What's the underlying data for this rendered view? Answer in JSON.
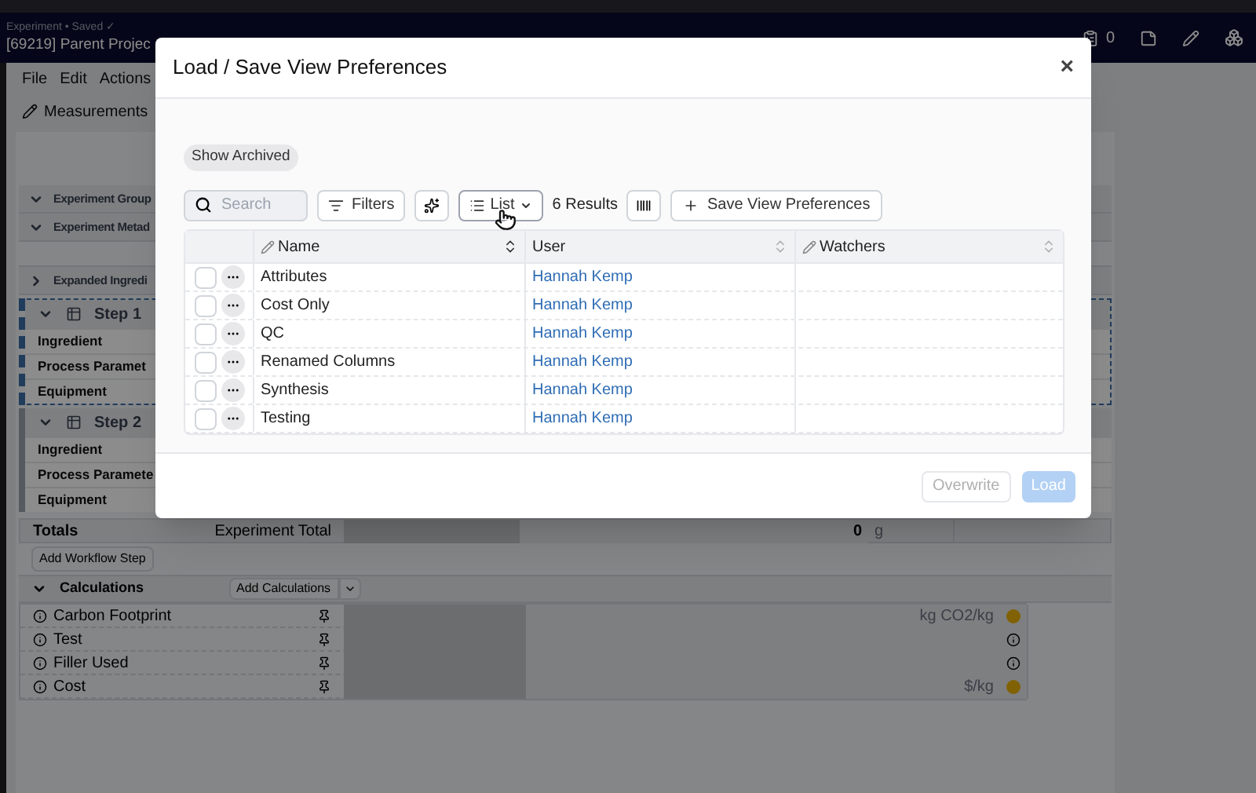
{
  "header": {
    "breadcrumb": "Experiment • Saved ✓",
    "title": "[69219] Parent Projec",
    "counter": "0"
  },
  "menu": [
    "File",
    "Edit",
    "Actions"
  ],
  "toolbar": {
    "tab": "Measurements"
  },
  "sections": [
    {
      "kind": "section",
      "label": "Experiment Group",
      "expanded": true
    },
    {
      "kind": "section",
      "label": "Experiment Metad",
      "expanded": true
    },
    {
      "kind": "spacer"
    },
    {
      "kind": "section",
      "label": "Expanded Ingredi",
      "expanded": false
    },
    {
      "kind": "step",
      "label": "Step 1",
      "expanded": true,
      "selected": true,
      "rows": [
        "Ingredient",
        "Process Paramet",
        "Equipment"
      ]
    },
    {
      "kind": "step",
      "label": "Step 2",
      "expanded": true,
      "selected": false,
      "rows": [
        "Ingredient",
        "Process Paramete",
        "Equipment"
      ]
    }
  ],
  "totals": {
    "label": "Totals",
    "name": "Experiment Total",
    "value": "0",
    "unit": "g"
  },
  "add_step_button": "Add Workflow Step",
  "calculations": {
    "label": "Calculations",
    "expanded": true,
    "add_button": "Add Calculations",
    "rows": [
      {
        "name": "Carbon Footprint",
        "unit": "kg CO2/kg",
        "kind": "warning"
      },
      {
        "name": "Test",
        "kind": "info"
      },
      {
        "name": "Filler Used",
        "kind": "info"
      },
      {
        "name": "Cost",
        "unit": "$/kg",
        "kind": "warning"
      }
    ]
  },
  "dialog": {
    "title": "Load / Save View Preferences",
    "close": "×",
    "show_archived": "Show Archived",
    "search": {
      "placeholder": "Search"
    },
    "filters": "Filters",
    "view": "List",
    "results": "6 Results",
    "save_button": "Save View Preferences",
    "columns": [
      {
        "label": "Name",
        "editable": true,
        "sorted": true
      },
      {
        "label": "User",
        "editable": false,
        "sorted": false
      },
      {
        "label": "Watchers",
        "editable": true,
        "sorted": false
      }
    ],
    "rows": [
      {
        "name": "Attributes",
        "user": "Hannah Kemp",
        "checked": false
      },
      {
        "name": "Cost Only",
        "user": "Hannah Kemp",
        "checked": false
      },
      {
        "name": "QC",
        "user": "Hannah Kemp",
        "checked": false
      },
      {
        "name": "Renamed Columns",
        "user": "Hannah Kemp",
        "checked": false
      },
      {
        "name": "Synthesis",
        "user": "Hannah Kemp",
        "checked": false
      },
      {
        "name": "Testing",
        "user": "Hannah Kemp",
        "checked": false
      }
    ],
    "buttons": [
      {
        "label": "Overwrite",
        "kind": "secondary",
        "disabled": true
      },
      {
        "label": "Load",
        "kind": "primary",
        "disabled": true
      }
    ]
  }
}
